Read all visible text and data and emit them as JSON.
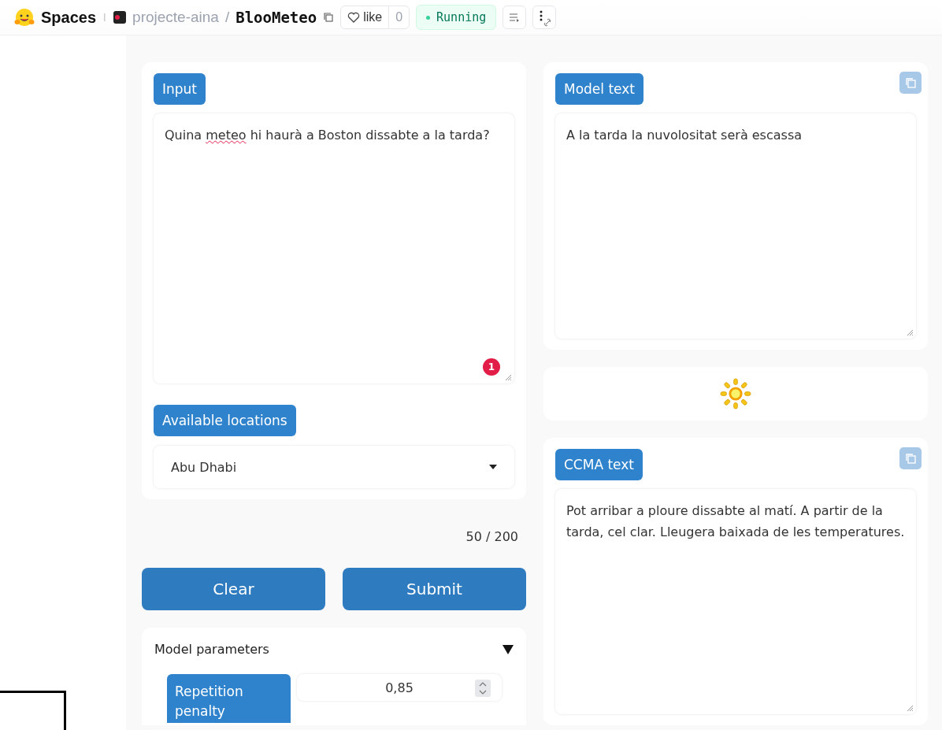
{
  "header": {
    "brand": "Spaces",
    "owner": "projecte-aina",
    "separator": "/",
    "repo": "BlooMeteo",
    "like_label": "like",
    "like_count": "0",
    "status": "Running",
    "running": true
  },
  "input_panel": {
    "label": "Input",
    "segments": [
      {
        "text": "Quina ",
        "misspelled": false
      },
      {
        "text": "meteo",
        "misspelled": true
      },
      {
        "text": " hi haurà a Boston dissabte a la tarda?",
        "misspelled": false
      }
    ],
    "badge": "1"
  },
  "locations": {
    "label": "Available locations",
    "value": "Abu Dhabi"
  },
  "counter": "50 / 200",
  "buttons": [
    {
      "label": "Clear"
    },
    {
      "label": "Submit"
    }
  ],
  "parameters": {
    "title": "Model parameters",
    "expanded": true,
    "fields": [
      {
        "label": "Repetition penalty",
        "value": "0,85"
      }
    ]
  },
  "model_output": {
    "label": "Model text",
    "text": "A la tarda la nuvolositat serà escassa"
  },
  "weather": {
    "kind": "sunny"
  },
  "ccma_output": {
    "label": "CCMA text",
    "text": "Pot arribar a ploure dissabte al matí. A partir de la tarda, cel clar. Lleugera baixada de les temperatures."
  }
}
